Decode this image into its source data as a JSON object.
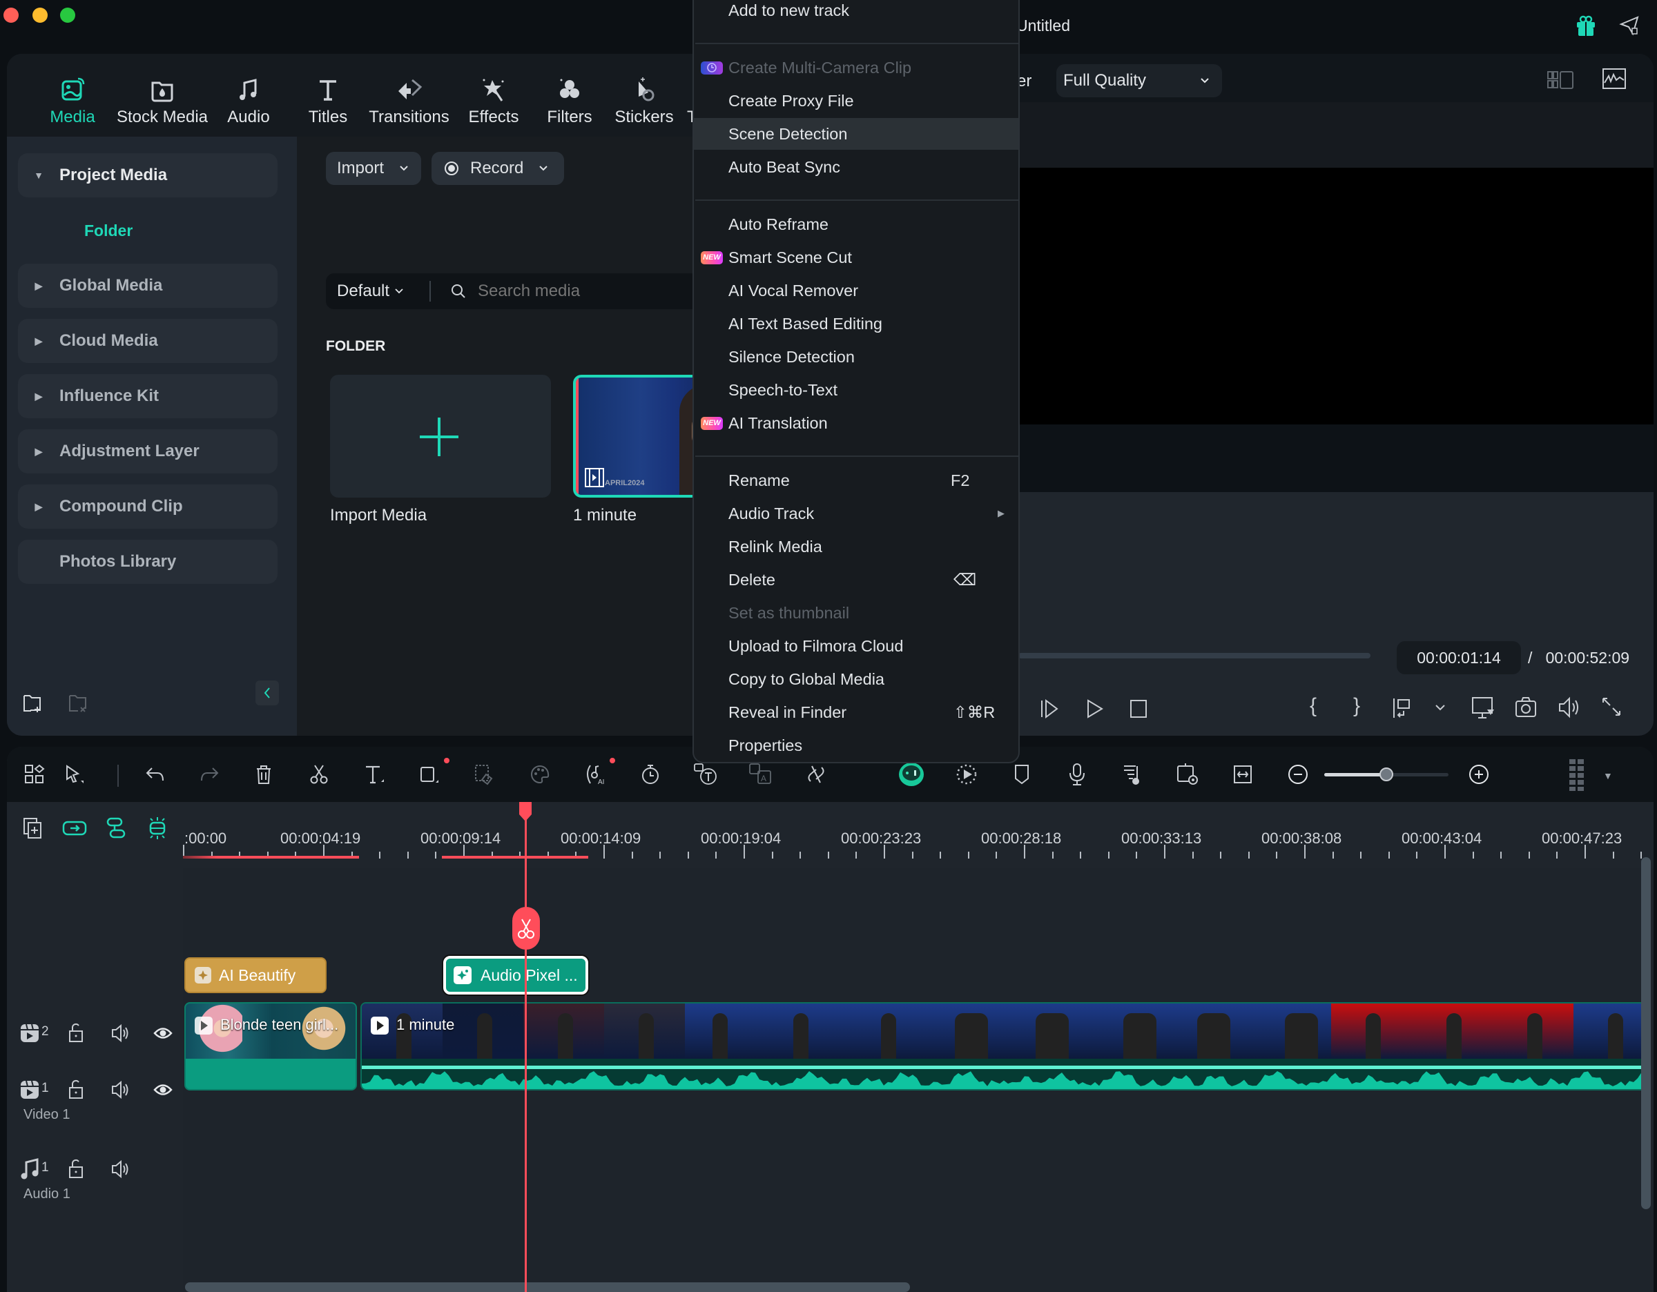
{
  "window": {
    "project_title": "Untitled",
    "traffic_lights": [
      "close",
      "minimize",
      "zoom"
    ],
    "top_right_icons": [
      "gift-icon",
      "send-feedback-icon"
    ]
  },
  "nav_tabs": [
    {
      "label": "Media",
      "icon": "media-icon",
      "active": true
    },
    {
      "label": "Stock Media",
      "icon": "stock-media-icon",
      "active": false
    },
    {
      "label": "Audio",
      "icon": "music-note-icon",
      "active": false
    },
    {
      "label": "Titles",
      "icon": "text-t-icon",
      "active": false
    },
    {
      "label": "Transitions",
      "icon": "transitions-icon",
      "active": false
    },
    {
      "label": "Effects",
      "icon": "effects-star-icon",
      "active": false
    },
    {
      "label": "Filters",
      "icon": "filters-circles-icon",
      "active": false
    },
    {
      "label": "Stickers",
      "icon": "stickers-icon",
      "active": false
    },
    {
      "label": "T",
      "icon": "templates-icon",
      "active": false
    }
  ],
  "sidebar": {
    "items": [
      {
        "label": "Project Media",
        "expanded": true
      },
      {
        "label": "Global Media",
        "expanded": false
      },
      {
        "label": "Cloud Media",
        "expanded": false
      },
      {
        "label": "Influence Kit",
        "expanded": false
      },
      {
        "label": "Adjustment Layer",
        "expanded": false
      },
      {
        "label": "Compound Clip",
        "expanded": false
      },
      {
        "label": "Photos Library",
        "expanded": false
      }
    ],
    "folder_label": "Folder"
  },
  "media": {
    "import_label": "Import",
    "record_label": "Record",
    "sort_label": "Default",
    "search_placeholder": "Search media",
    "folder_heading": "FOLDER",
    "tiles": [
      {
        "label": "Import Media",
        "type": "import"
      },
      {
        "label": "1 minute",
        "type": "video",
        "overlay_text": "APRIL2024",
        "selected": true
      }
    ]
  },
  "preview": {
    "player_label_partial": "er",
    "quality": "Full Quality",
    "current_time": "00:00:01:14",
    "separator": "/",
    "total_time": "00:00:52:09"
  },
  "context_menu": {
    "items": [
      {
        "label": "Add to new track",
        "type": "item"
      },
      {
        "type": "separator"
      },
      {
        "label": "Create Multi-Camera Clip",
        "type": "item",
        "disabled": true,
        "badge": "camera"
      },
      {
        "label": "Create Proxy File",
        "type": "item"
      },
      {
        "label": "Scene Detection",
        "type": "item",
        "highlighted": true
      },
      {
        "label": "Auto Beat Sync",
        "type": "item"
      },
      {
        "type": "separator"
      },
      {
        "label": "Auto Reframe",
        "type": "item"
      },
      {
        "label": "Smart Scene Cut",
        "type": "item",
        "badge": "NEW"
      },
      {
        "label": "AI Vocal Remover",
        "type": "item"
      },
      {
        "label": "AI Text Based Editing",
        "type": "item"
      },
      {
        "label": "Silence Detection",
        "type": "item"
      },
      {
        "label": "Speech-to-Text",
        "type": "item"
      },
      {
        "label": "AI Translation",
        "type": "item",
        "badge": "NEW"
      },
      {
        "type": "separator"
      },
      {
        "label": "Rename",
        "type": "item",
        "shortcut": "F2"
      },
      {
        "label": "Audio Track",
        "type": "item",
        "submenu": true
      },
      {
        "label": "Relink Media",
        "type": "item"
      },
      {
        "label": "Delete",
        "type": "item",
        "shortcut": "⌫"
      },
      {
        "label": "Set as thumbnail",
        "type": "item",
        "disabled": true
      },
      {
        "label": "Upload to Filmora Cloud",
        "type": "item"
      },
      {
        "label": "Copy to Global Media",
        "type": "item"
      },
      {
        "label": "Reveal in Finder",
        "type": "item",
        "shortcut": "⇧⌘R"
      },
      {
        "label": "Properties",
        "type": "item"
      }
    ]
  },
  "timeline": {
    "zoom_level": 0.5,
    "ruler_labels": [
      ":00:00",
      "00:00:04:19",
      "00:00:09:14",
      "00:00:14:09",
      "00:00:19:04",
      "00:00:23:23",
      "00:00:28:18",
      "00:00:33:13",
      "00:00:38:08",
      "00:00:43:04",
      "00:00:47:23"
    ],
    "tracks": [
      {
        "number": "2",
        "name": "",
        "type": "video"
      },
      {
        "number": "1",
        "name": "Video 1",
        "type": "video"
      },
      {
        "number": "1",
        "name": "Audio 1",
        "type": "audio"
      }
    ],
    "clips": {
      "effect_1": "AI Beautify",
      "effect_2": "Audio Pixel ...",
      "video_1": "Blonde teen girl...",
      "video_2": "1 minute"
    }
  }
}
